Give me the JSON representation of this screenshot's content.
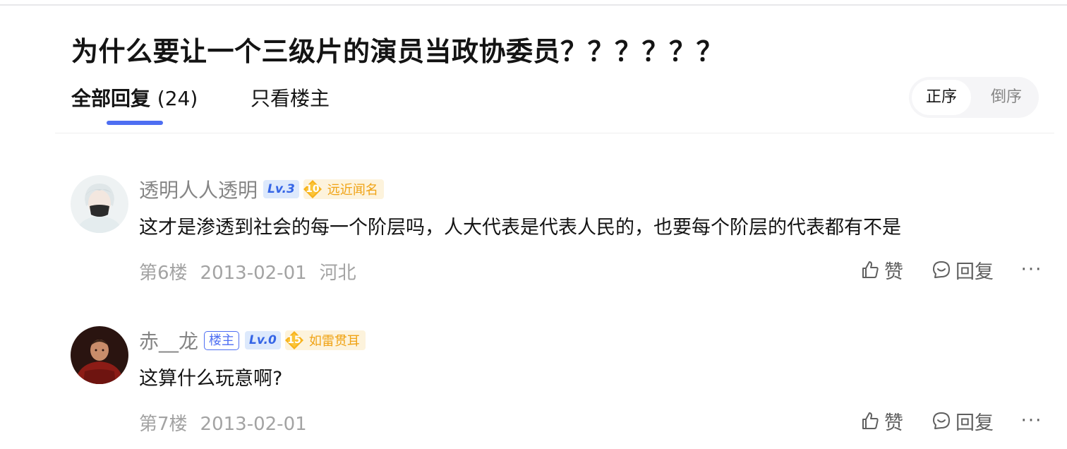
{
  "post": {
    "title": "为什么要让一个三级片的演员当政协委员？？？？？？"
  },
  "tabs": {
    "all_label": "全部回复",
    "all_count": "(24)",
    "op_only_label": "只看楼主"
  },
  "sort": {
    "asc_label": "正序",
    "desc_label": "倒序"
  },
  "replies": [
    {
      "username": "透明人人透明",
      "level": "Lv.3",
      "rank_number": "10",
      "rank_title": "远近闻名",
      "text": "这才是渗透到社会的每一个阶层吗，人大代表是代表人民的，也要每个阶层的代表都有不是",
      "floor": "第6楼",
      "date": "2013-02-01",
      "location": "河北",
      "like_label": "赞",
      "reply_label": "回复",
      "more_label": "···"
    },
    {
      "username": "赤__龙",
      "op_badge": "楼主",
      "level": "Lv.0",
      "rank_number": "15",
      "rank_title": "如雷贯耳",
      "text": "这算什么玩意啊?",
      "floor": "第7楼",
      "date": "2013-02-01",
      "like_label": "赞",
      "reply_label": "回复",
      "more_label": "···"
    }
  ],
  "colors": {
    "accent": "#4e6ef2",
    "badge_gold": "#f0a315",
    "muted_text": "#a3a3a3"
  },
  "icons": [
    "thumbs-up-icon",
    "comment-icon",
    "more-icon",
    "rank-diamond-icon"
  ]
}
